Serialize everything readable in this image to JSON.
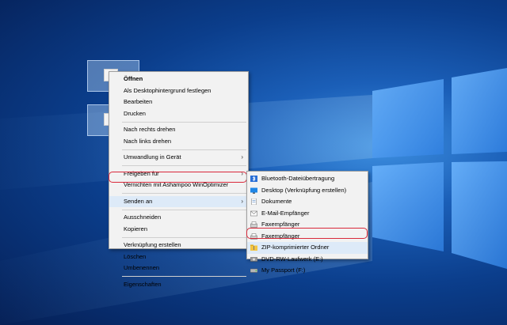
{
  "context_menu": {
    "items": [
      {
        "label": "Öffnen",
        "bold": true
      },
      {
        "label": "Als Desktophintergrund festlegen"
      },
      {
        "label": "Bearbeiten"
      },
      {
        "label": "Drucken"
      },
      {
        "sep": true
      },
      {
        "label": "Nach rechts drehen"
      },
      {
        "label": "Nach links drehen"
      },
      {
        "sep": true
      },
      {
        "label": "Umwandlung in Gerät",
        "submenu": true
      },
      {
        "sep": true
      },
      {
        "label": "Freigeben für",
        "submenu": true
      },
      {
        "label": "Vernichten mit Ashampoo WinOptimizer"
      },
      {
        "sep": true
      },
      {
        "label": "Senden an",
        "submenu": true,
        "highlighted": true
      },
      {
        "sep": true
      },
      {
        "label": "Ausschneiden"
      },
      {
        "label": "Kopieren"
      },
      {
        "sep": true
      },
      {
        "label": "Verknüpfung erstellen"
      },
      {
        "label": "Löschen"
      },
      {
        "label": "Umbenennen"
      },
      {
        "sep": true
      },
      {
        "label": "Eigenschaften"
      }
    ]
  },
  "send_to_menu": {
    "items": [
      {
        "label": "Bluetooth-Dateiübertragung",
        "icon": "bluetooth-icon"
      },
      {
        "label": "Desktop (Verknüpfung erstellen)",
        "icon": "desktop-icon"
      },
      {
        "label": "Dokumente",
        "icon": "documents-icon"
      },
      {
        "label": "E-Mail-Empfänger",
        "icon": "mail-icon"
      },
      {
        "label": "Faxempfänger",
        "icon": "fax-icon"
      },
      {
        "label": "Faxempfänger",
        "icon": "fax-icon"
      },
      {
        "label": "ZIP-komprimierter Ordner",
        "icon": "zip-folder-icon",
        "highlighted": true
      },
      {
        "label": "DVD-RW-Laufwerk (E:)",
        "icon": "dvd-drive-icon"
      },
      {
        "label": "My Passport (F:)",
        "icon": "drive-icon"
      }
    ]
  },
  "colors": {
    "highlight_ring": "#d9283a",
    "menu_bg": "#f2f2f2",
    "desktop_blue": "#0b3e8c"
  }
}
